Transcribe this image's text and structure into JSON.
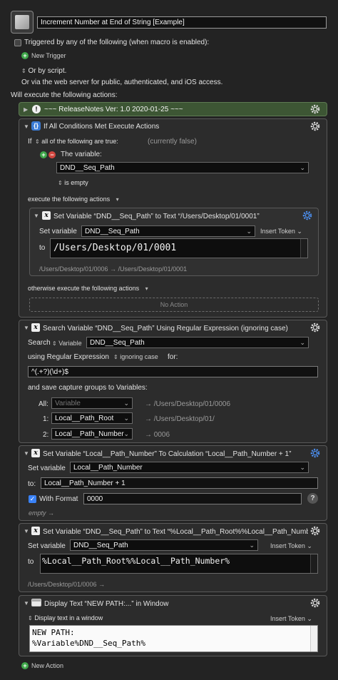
{
  "macro": {
    "name": "Increment Number at End of String [Example]"
  },
  "triggers": {
    "triggered_by_label": "Triggered by any of the following (when macro is enabled):",
    "new_trigger": "New Trigger",
    "or_by_script": "Or by script.",
    "web_server": "Or via the web server for public, authenticated, and iOS access."
  },
  "will_execute": "Will execute the following actions:",
  "comment_action": {
    "title": "~~~ ReleaseNotes   Ver: 1.0   2020-01-25 ~~~",
    "color": "#4a6a3c"
  },
  "if_action": {
    "title": "If All Conditions Met Execute Actions",
    "if_label": "If",
    "all_of": "all of the following are true:",
    "currently": "(currently false)",
    "the_variable": "The variable:",
    "variable": "DND__Seq_Path",
    "is_empty": "is empty",
    "execute_label": "execute the following actions",
    "inner": {
      "title": "Set Variable “DND__Seq_Path” to Text “/Users/Desktop/01/0001”",
      "set_variable_label": "Set variable",
      "variable": "DND__Seq_Path",
      "insert_token": "Insert Token",
      "to_label": "to",
      "text": "/Users/Desktop/01/0001",
      "preview": "/Users/Desktop/01/0006 → /Users/Desktop/01/0001"
    },
    "otherwise_label": "otherwise execute the following actions",
    "no_action": "No Action"
  },
  "search_action": {
    "title": "Search Variable “DND__Seq_Path” Using Regular Expression (ignoring case)",
    "search_label": "Search",
    "variable_type": "Variable",
    "variable": "DND__Seq_Path",
    "using_label": "using Regular Expression",
    "case_option": "ignoring case",
    "for_label": "for:",
    "regex": "^(.+?)(\\d+)$",
    "save_label": "and save capture groups to Variables:",
    "groups": [
      {
        "label": "All:",
        "value": "",
        "placeholder": "Variable",
        "result": "→ /Users/Desktop/01/0006"
      },
      {
        "label": "1:",
        "value": "Local__Path_Root",
        "placeholder": "",
        "result": "→ /Users/Desktop/01/"
      },
      {
        "label": "2:",
        "value": "Local__Path_Number",
        "placeholder": "",
        "result": "→ 0006"
      }
    ]
  },
  "calc_action": {
    "title": "Set Variable “Local__Path_Number” To Calculation “Local__Path_Number + 1”",
    "set_variable_label": "Set variable",
    "variable": "Local__Path_Number",
    "to_label": "to:",
    "calculation": "Local__Path_Number + 1",
    "with_format_label": "With Format",
    "with_format_checked": true,
    "format": "0000",
    "help": "?",
    "result": "empty"
  },
  "set_action": {
    "title": "Set Variable “DND__Seq_Path” to Text “%Local__Path_Root%%Local__Path_Number...",
    "set_variable_label": "Set variable",
    "variable": "DND__Seq_Path",
    "insert_token": "Insert Token",
    "to_label": "to",
    "text": "%Local__Path_Root%%Local__Path_Number%",
    "preview": "/Users/Desktop/01/0006"
  },
  "display_action": {
    "title": "Display Text “NEW PATH:...” in Window",
    "mode": "Display text in a window",
    "insert_token": "Insert Token",
    "text_line1": "NEW PATH:",
    "text_line2": "%Variable%DND__Seq_Path%"
  },
  "new_action": "New Action"
}
